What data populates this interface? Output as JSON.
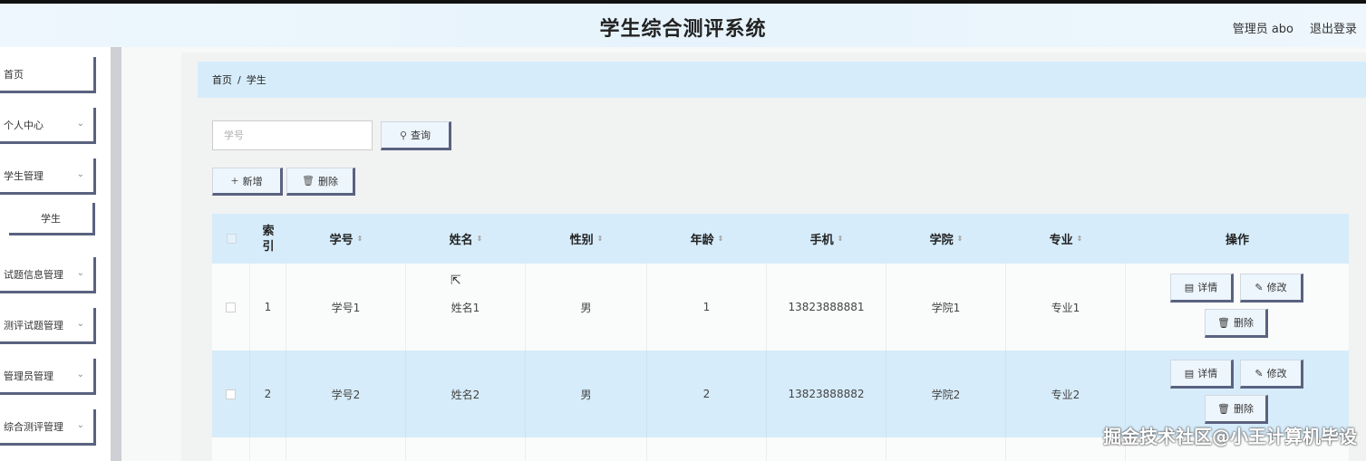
{
  "header": {
    "title": "学生综合测评系统",
    "user": "管理员 abo",
    "logout": "退出登录"
  },
  "sidebar": {
    "items": [
      {
        "label": "首页",
        "expandable": false
      },
      {
        "label": "个人中心",
        "expandable": true
      },
      {
        "label": "学生管理",
        "expandable": true
      },
      {
        "label": "试题信息管理",
        "expandable": true
      },
      {
        "label": "测评试题管理",
        "expandable": true
      },
      {
        "label": "管理员管理",
        "expandable": true
      },
      {
        "label": "综合测评管理",
        "expandable": true
      }
    ],
    "subitem": "学生"
  },
  "breadcrumb": {
    "home": "首页",
    "separator": "/",
    "current": "学生"
  },
  "search": {
    "placeholder": "学号",
    "button": "查询"
  },
  "toolbar": {
    "add": "新增",
    "delete": "删除"
  },
  "table": {
    "columns": [
      "索引",
      "学号",
      "姓名",
      "性别",
      "年龄",
      "手机",
      "学院",
      "专业",
      "操作"
    ],
    "index_header_line1": "索",
    "index_header_line2": "引",
    "rows": [
      {
        "index": "1",
        "student_id": "学号1",
        "name": "姓名1",
        "gender": "男",
        "age": "1",
        "phone": "13823888881",
        "college": "学院1",
        "major": "专业1"
      },
      {
        "index": "2",
        "student_id": "学号2",
        "name": "姓名2",
        "gender": "男",
        "age": "2",
        "phone": "13823888882",
        "college": "学院2",
        "major": "专业2"
      }
    ],
    "actions": {
      "detail": "详情",
      "edit": "修改",
      "delete": "删除"
    }
  },
  "watermark": "掘金技术社区@小王计算机毕设",
  "colors": {
    "accent": "#5a6280",
    "header_bg": "#d6ecfa"
  }
}
